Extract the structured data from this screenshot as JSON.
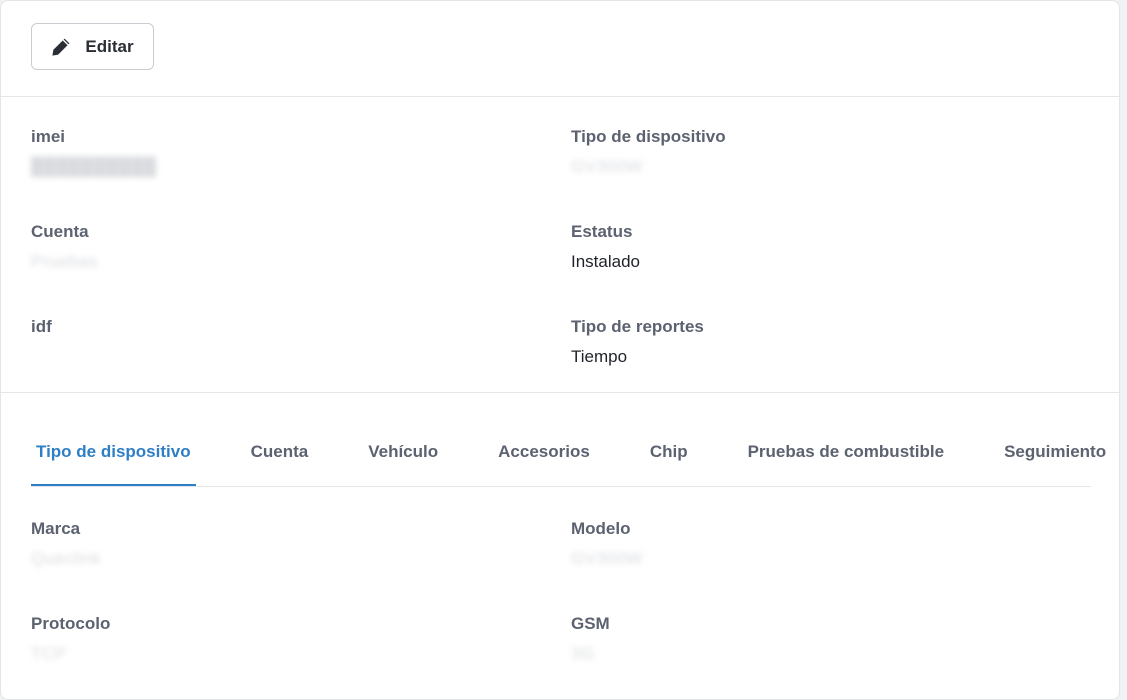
{
  "toolbar": {
    "edit_label": "Editar"
  },
  "details": {
    "imei": {
      "label": "imei",
      "value": "██████████"
    },
    "device_type": {
      "label": "Tipo de dispositivo",
      "value": "GV300W"
    },
    "account": {
      "label": "Cuenta",
      "value": "Pruebas"
    },
    "status": {
      "label": "Estatus",
      "value": "Instalado"
    },
    "idf": {
      "label": "idf",
      "value": ""
    },
    "report_type": {
      "label": "Tipo de reportes",
      "value": "Tiempo"
    }
  },
  "tabs": [
    {
      "label": "Tipo de dispositivo",
      "active": true
    },
    {
      "label": "Cuenta",
      "active": false
    },
    {
      "label": "Vehículo",
      "active": false
    },
    {
      "label": "Accesorios",
      "active": false
    },
    {
      "label": "Chip",
      "active": false
    },
    {
      "label": "Pruebas de combustible",
      "active": false
    },
    {
      "label": "Seguimiento",
      "active": false
    }
  ],
  "tab_content": {
    "brand": {
      "label": "Marca",
      "value": "Queclink"
    },
    "model": {
      "label": "Modelo",
      "value": "GV300W"
    },
    "protocol": {
      "label": "Protocolo",
      "value": "TCP"
    },
    "gsm": {
      "label": "GSM",
      "value": "3G"
    }
  },
  "colors": {
    "accent": "#2f7fc6",
    "label": "#5c6270",
    "value": "#1f2329"
  },
  "icons": {
    "edit": "pencil-icon"
  }
}
